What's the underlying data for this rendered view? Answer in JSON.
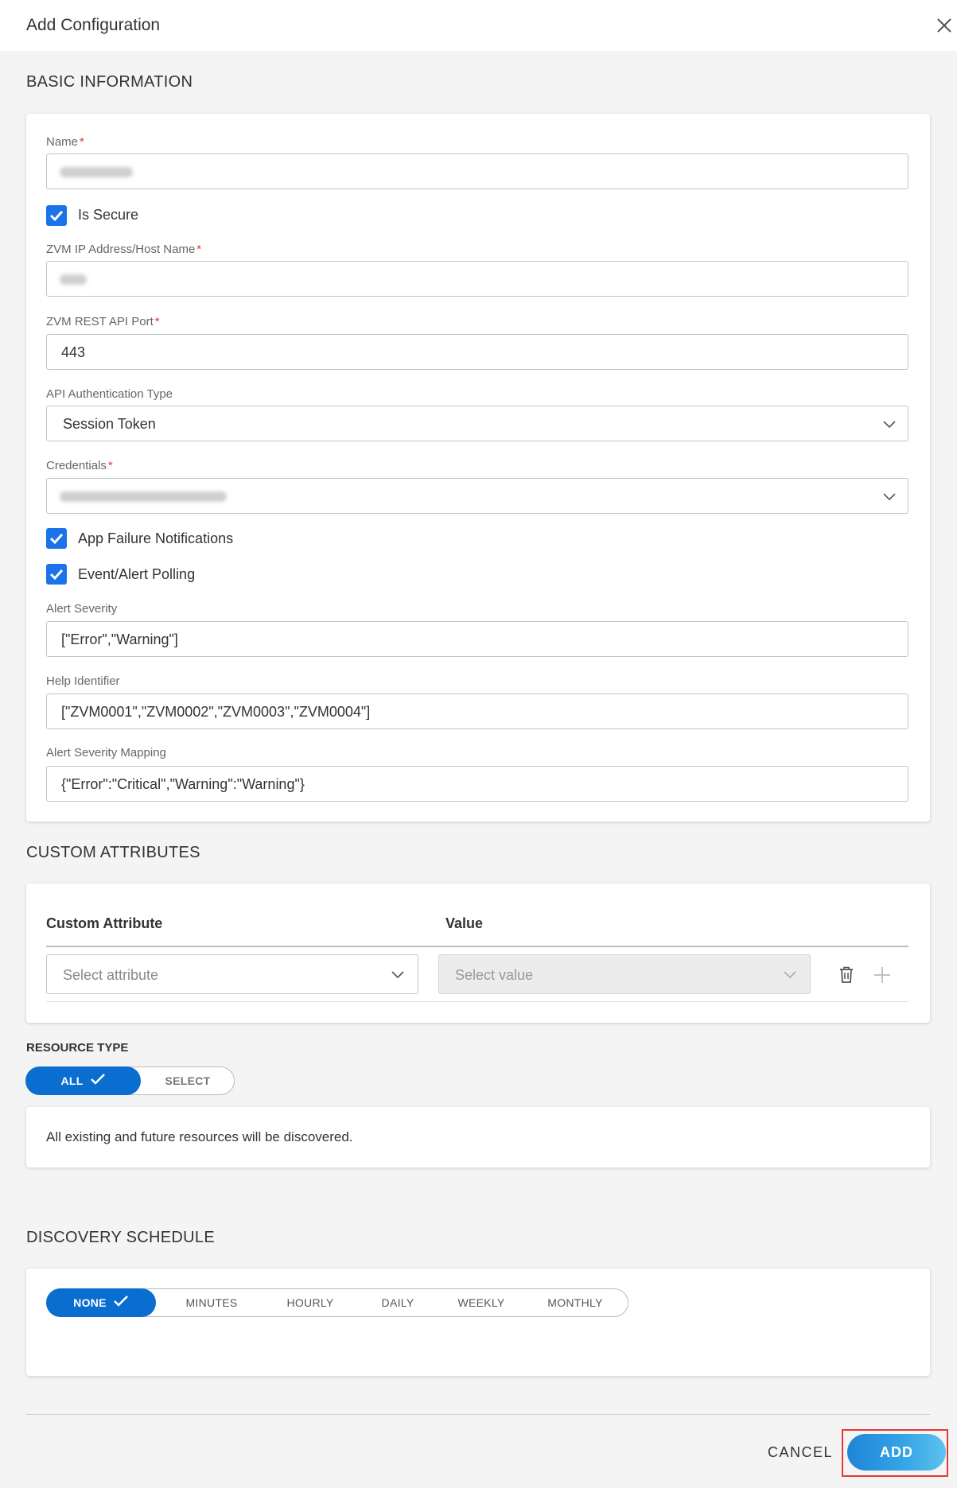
{
  "dialog": {
    "title": "Add Configuration",
    "close_icon": "close-icon"
  },
  "basic": {
    "title": "BASIC INFORMATION",
    "name": {
      "label": "Name",
      "required": "*"
    },
    "is_secure": {
      "label": "Is Secure",
      "checked": true
    },
    "zvm_host": {
      "label": "ZVM IP Address/Host Name",
      "required": "*"
    },
    "api_port": {
      "label": "ZVM REST API Port",
      "required": "*",
      "value": "443"
    },
    "auth_type": {
      "label": "API Authentication Type",
      "value": "Session Token"
    },
    "credentials": {
      "label": "Credentials",
      "required": "*"
    },
    "app_failure": {
      "label": "App Failure Notifications",
      "checked": true
    },
    "event_polling": {
      "label": "Event/Alert Polling",
      "checked": true
    },
    "alert_severity": {
      "label": "Alert Severity",
      "value": "[\"Error\",\"Warning\"]"
    },
    "help_identifier": {
      "label": "Help Identifier",
      "value": "[\"ZVM0001\",\"ZVM0002\",\"ZVM0003\",\"ZVM0004\"]"
    },
    "severity_mapping": {
      "label": "Alert Severity Mapping",
      "value": "{\"Error\":\"Critical\",\"Warning\":\"Warning\"}"
    }
  },
  "custom": {
    "title": "CUSTOM ATTRIBUTES",
    "col_attribute": "Custom Attribute",
    "col_value": "Value",
    "attribute_placeholder": "Select attribute",
    "value_placeholder": "Select value",
    "delete_icon": "trash-icon",
    "add_icon": "plus-icon"
  },
  "resource": {
    "title": "RESOURCE TYPE",
    "options": [
      "ALL",
      "SELECT"
    ],
    "selected": "ALL",
    "message": "All existing and future resources will be discovered."
  },
  "schedule": {
    "title": "DISCOVERY SCHEDULE",
    "options": [
      "NONE",
      "MINUTES",
      "HOURLY",
      "DAILY",
      "WEEKLY",
      "MONTHLY"
    ],
    "selected": "NONE"
  },
  "footer": {
    "cancel_label": "CANCEL",
    "add_label": "ADD"
  },
  "colors": {
    "primary": "#0a6ed1",
    "checkbox": "#1a73e8",
    "required": "#e53935",
    "highlight_frame": "#e53935"
  }
}
